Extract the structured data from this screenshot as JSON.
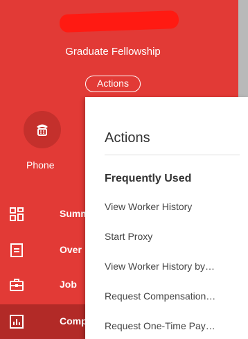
{
  "header": {
    "role_title": "Graduate Fellowship",
    "actions_button": "Actions"
  },
  "phone": {
    "label": "Phone",
    "icon": "phone-icon"
  },
  "nav": {
    "items": [
      {
        "label": "Summ",
        "icon": "summary-grid-icon",
        "active": false
      },
      {
        "label": "Over",
        "icon": "overview-doc-icon",
        "active": false
      },
      {
        "label": "Job",
        "icon": "briefcase-icon",
        "active": false
      },
      {
        "label": "Comp",
        "icon": "bar-chart-icon",
        "active": true
      }
    ]
  },
  "menu": {
    "title": "Actions",
    "section_title": "Frequently Used",
    "items": [
      "View Worker History",
      "Start Proxy",
      "View Worker History by…",
      "Request Compensation…",
      "Request One-Time Pay…"
    ]
  },
  "colors": {
    "brand_red": "#e23a36",
    "active_item": "#b22a27",
    "menu_bg": "#ffffff"
  }
}
